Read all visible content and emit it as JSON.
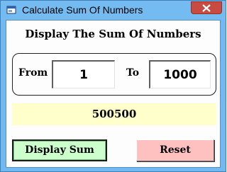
{
  "window": {
    "title": "Calculate Sum Of Numbers",
    "title_bar_color": "#73bbf1",
    "close_button_color": "#c74b40"
  },
  "main": {
    "heading": "Display The Sum Of Numbers",
    "from_label": "From",
    "from_value": "1",
    "to_label": "To",
    "to_value": "1000",
    "result": "500500",
    "result_background": "#ffffcc"
  },
  "buttons": {
    "display_sum": "Display Sum",
    "display_sum_color": "#ccffcc",
    "reset": "Reset",
    "reset_color": "#ffc0c0"
  },
  "icons": {
    "app": "app-window-icon",
    "close": "close-icon"
  }
}
